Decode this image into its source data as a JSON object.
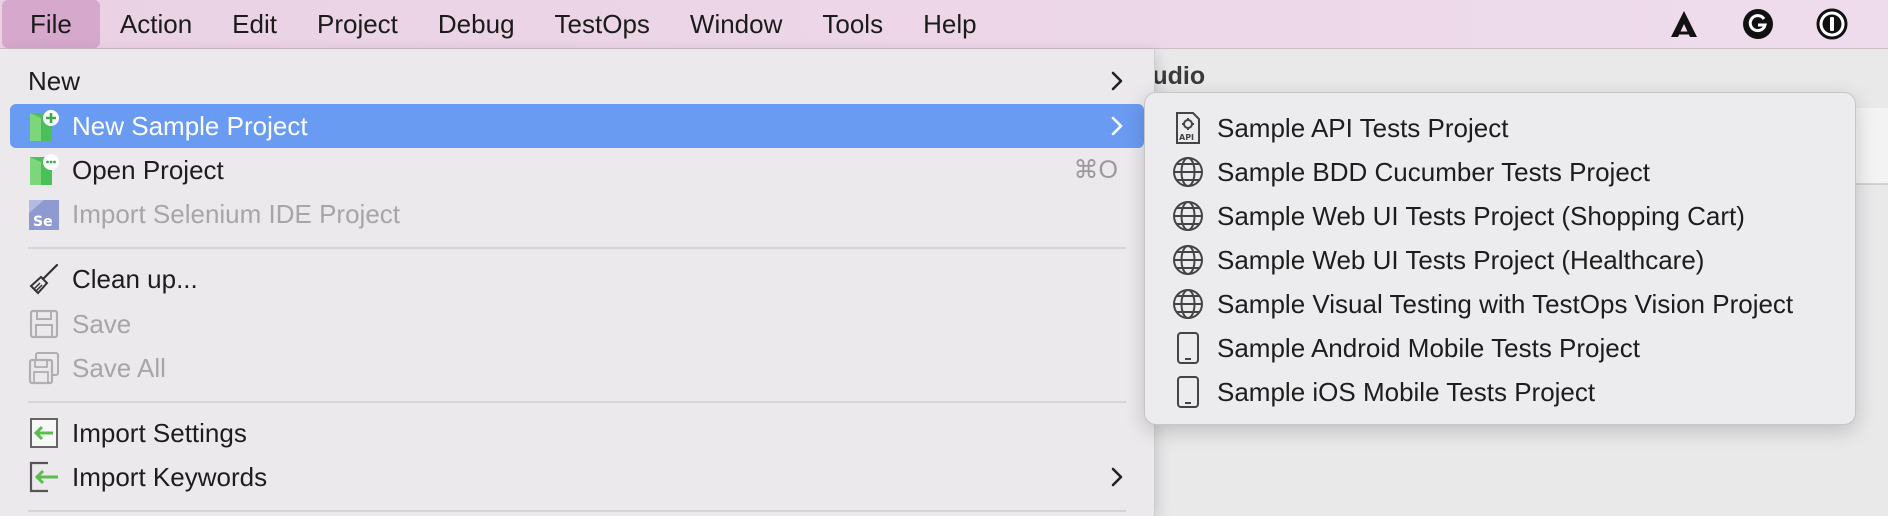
{
  "menubar": {
    "items": [
      "File",
      "Action",
      "Edit",
      "Project",
      "Debug",
      "TestOps",
      "Window",
      "Tools",
      "Help"
    ],
    "tray_icons": [
      "app-a-icon",
      "grammarly-icon",
      "onepassword-icon"
    ]
  },
  "background_window": {
    "title_fragment": "tudio"
  },
  "file_menu": {
    "new": "New",
    "new_sample_project": "New Sample Project",
    "open_project": "Open Project",
    "open_project_shortcut": "⌘O",
    "import_selenium": "Import Selenium IDE Project",
    "clean_up": "Clean up...",
    "save": "Save",
    "save_all": "Save All",
    "import_settings": "Import Settings",
    "import_keywords": "Import Keywords"
  },
  "submenu": {
    "items": [
      {
        "label": "Sample API Tests Project",
        "icon": "api-icon"
      },
      {
        "label": "Sample BDD Cucumber Tests Project",
        "icon": "globe-icon"
      },
      {
        "label": "Sample Web UI Tests Project (Shopping Cart)",
        "icon": "globe-icon"
      },
      {
        "label": "Sample Web UI Tests Project (Healthcare)",
        "icon": "globe-icon"
      },
      {
        "label": "Sample Visual Testing with TestOps Vision Project",
        "icon": "globe-icon"
      },
      {
        "label": "Sample Android Mobile Tests Project",
        "icon": "mobile-icon"
      },
      {
        "label": "Sample iOS Mobile Tests Project",
        "icon": "mobile-icon"
      }
    ]
  },
  "colors": {
    "highlight": "#6a9bf2",
    "menubar_active": "#d6a8cc"
  }
}
